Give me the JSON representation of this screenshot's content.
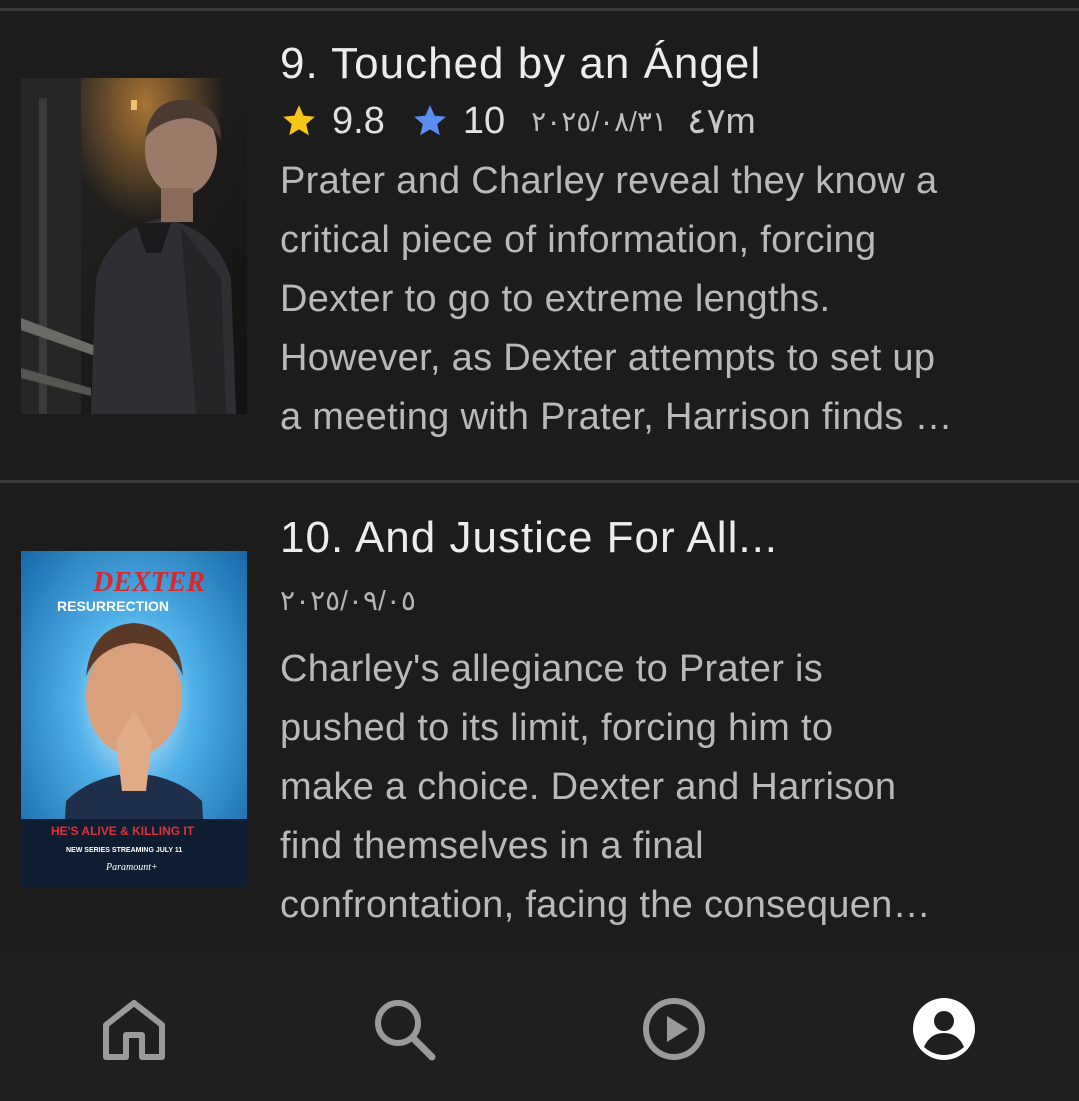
{
  "episodes": [
    {
      "title": "9. Touched by an Ángel",
      "rating": "9.8",
      "user_rating": "10",
      "date": "٢٠٢٥/٠٨/٣١",
      "runtime": "٤٧m",
      "description_lines": [
        "Prater and Charley reveal they know a",
        "critical piece of information, forcing",
        "Dexter to go to extreme lengths.",
        "However, as Dexter attempts to set up",
        "a meeting with Prater, Harrison finds …"
      ]
    },
    {
      "title": "10. And Justice For All...",
      "date": "٢٠٢٥/٠٩/٠٥",
      "description_lines": [
        "Charley's allegiance to Prater is",
        "pushed to its limit, forcing him to",
        "make a choice. Dexter and Harrison",
        "find themselves in a final",
        "confrontation, facing the consequen…"
      ],
      "poster": {
        "brand": "DEXTER",
        "subtitle": "RESURRECTION",
        "tagline": "HE'S ALIVE & KILLING IT",
        "release": "NEW SERIES STREAMING JULY 11",
        "network": "Paramount+"
      }
    }
  ],
  "colors": {
    "background": "#1c1c1c",
    "star_gold": "#f5c518",
    "star_blue": "#5a8dee",
    "divider": "#3a3a3a"
  },
  "icons": [
    "star-icon",
    "blue-star-icon",
    "home-icon",
    "search-icon",
    "play-icon",
    "profile-icon"
  ]
}
